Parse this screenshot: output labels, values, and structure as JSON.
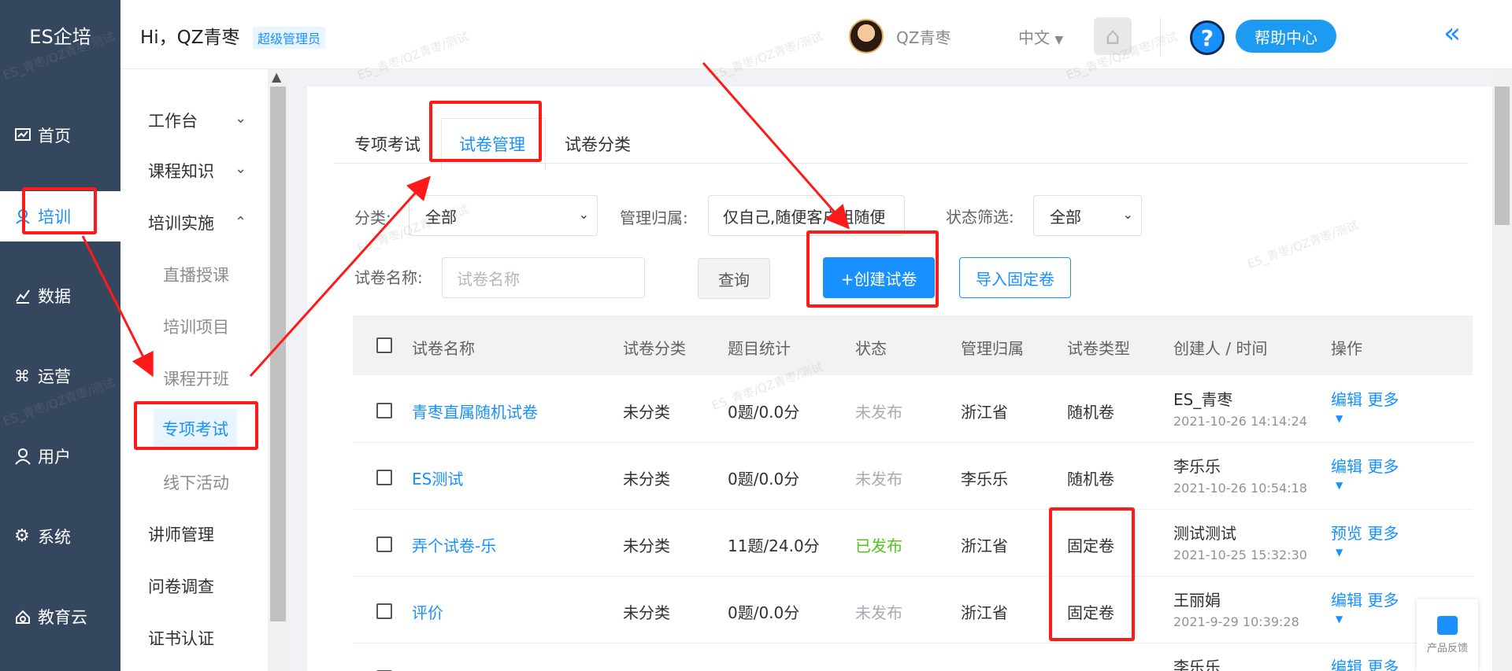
{
  "rail": {
    "logo": "ES企培",
    "items": [
      {
        "label": "首页",
        "icon": "chart-icon"
      },
      {
        "label": "培训",
        "icon": "training-icon"
      },
      {
        "label": "数据",
        "icon": "bar-chart-icon"
      },
      {
        "label": "运营",
        "icon": "command-icon"
      },
      {
        "label": "用户",
        "icon": "user-icon"
      },
      {
        "label": "系统",
        "icon": "gear-icon"
      },
      {
        "label": "教育云",
        "icon": "cloud-icon"
      }
    ],
    "active_index": 1
  },
  "topbar": {
    "greeting": "Hi，QZ青枣",
    "role": "超级管理员",
    "username": "QZ青枣",
    "language": "中文",
    "help_label": "帮助中心",
    "help_glyph": "?",
    "home_glyph": "⌂",
    "collapse_glyph": "«"
  },
  "submenu": {
    "groups": [
      {
        "label": "工作台"
      },
      {
        "label": "课程知识"
      },
      {
        "label": "培训实施"
      }
    ],
    "children": [
      "直播授课",
      "培训项目",
      "课程开班",
      "专项考试",
      "线下活动"
    ],
    "active_child": "专项考试",
    "more": [
      "讲师管理",
      "问卷调查",
      "证书认证"
    ]
  },
  "tabs": [
    "专项考试",
    "试卷管理",
    "试卷分类"
  ],
  "active_tab": "试卷管理",
  "filters": {
    "category_label": "分类:",
    "category_value": "全部",
    "ownership_label": "管理归属:",
    "ownership_value": "仅自己,随便客户组随便",
    "status_label": "状态筛选:",
    "status_value": "全部",
    "name_label": "试卷名称:",
    "name_placeholder": "试卷名称",
    "query_button": "查询",
    "create_button": "+创建试卷",
    "import_button": "导入固定卷"
  },
  "table": {
    "columns": [
      "试卷名称",
      "试卷分类",
      "题目统计",
      "状态",
      "管理归属",
      "试卷类型",
      "创建人 / 时间",
      "操作"
    ],
    "rows": [
      {
        "name": "青枣直属随机试卷",
        "category": "未分类",
        "stats": "0题/0.0分",
        "status": "未发布",
        "owner": "浙江省",
        "type": "随机卷",
        "creator": "ES_青枣",
        "time": "2021-10-26 14:14:24",
        "action1": "编辑",
        "action2": "更多"
      },
      {
        "name": "ES测试",
        "category": "未分类",
        "stats": "0题/0.0分",
        "status": "未发布",
        "owner": "李乐乐",
        "type": "随机卷",
        "creator": "李乐乐",
        "time": "2021-10-26 10:54:18",
        "action1": "编辑",
        "action2": "更多"
      },
      {
        "name": "弄个试卷-乐",
        "category": "未分类",
        "stats": "11题/24.0分",
        "status": "已发布",
        "owner": "浙江省",
        "type": "固定卷",
        "creator": "测试测试",
        "time": "2021-10-25 15:32:30",
        "action1": "预览",
        "action2": "更多"
      },
      {
        "name": "评价",
        "category": "未分类",
        "stats": "0题/0.0分",
        "status": "未发布",
        "owner": "浙江省",
        "type": "固定卷",
        "creator": "王丽娟",
        "time": "2021-9-29 10:39:28",
        "action1": "编辑",
        "action2": "更多"
      },
      {
        "name": "",
        "category": "",
        "stats": "",
        "status": "",
        "owner": "",
        "type": "",
        "creator": "李乐乐",
        "time": "",
        "action1": "编辑",
        "action2": "更多"
      }
    ]
  },
  "feedback_label": "产品反馈",
  "watermark": "ES_青枣/QZ青枣/测试",
  "colors": {
    "rail": "#35475f",
    "accent": "#1890ff",
    "annotation": "#ff1a1a",
    "published": "#52c41a"
  }
}
